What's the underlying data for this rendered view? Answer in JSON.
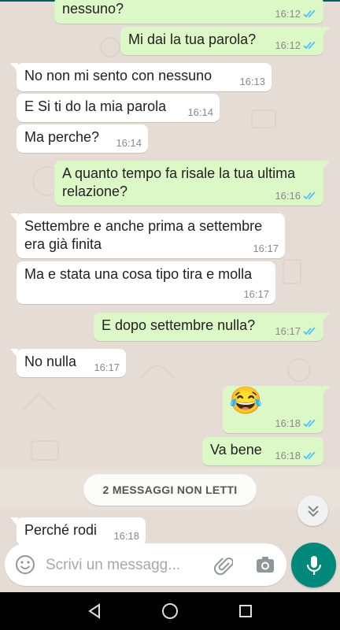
{
  "messages": [
    {
      "text": "nessuno?",
      "time": "16:12",
      "dir": "out",
      "ticks": true
    },
    {
      "text": "Mi dai la tua parola?",
      "time": "16:12",
      "dir": "out",
      "ticks": true
    },
    {
      "text": "No non mi sento con nessuno",
      "time": "16:13",
      "dir": "in",
      "ticks": false
    },
    {
      "text": "E Si ti do la mia parola",
      "time": "16:14",
      "dir": "in",
      "ticks": false
    },
    {
      "text": "Ma perche?",
      "time": "16:14",
      "dir": "in",
      "ticks": false
    },
    {
      "text": "A quanto tempo fa risale la tua ultima\nrelazione?",
      "time": "16:16",
      "dir": "out",
      "ticks": true
    },
    {
      "text": "Settembre e anche prima a settembre\nera già finita",
      "time": "16:17",
      "dir": "in",
      "ticks": false
    },
    {
      "text": "Ma e stata una cosa tipo tira e molla",
      "time": "16:17",
      "dir": "in",
      "ticks": false
    },
    {
      "text": "E dopo settembre nulla?",
      "time": "16:17",
      "dir": "out",
      "ticks": true
    },
    {
      "text": "No nulla",
      "time": "16:17",
      "dir": "in",
      "ticks": false
    },
    {
      "text": "😂",
      "time": "16:18",
      "dir": "out",
      "ticks": true
    },
    {
      "text": "Va bene",
      "time": "16:18",
      "dir": "out",
      "ticks": true
    },
    {
      "text": "Perché rodi",
      "time": "16:18",
      "dir": "in",
      "ticks": false
    }
  ],
  "unread_banner": "2 MESSAGGI NON LETTI",
  "input": {
    "placeholder": "Scrivi un messagg..."
  },
  "icons": {
    "emoji": "emoji-icon",
    "attach": "paperclip-icon",
    "camera": "camera-icon",
    "mic": "microphone-icon",
    "scroll": "double-chevron-down-icon",
    "back": "back-triangle-icon",
    "home": "home-circle-icon",
    "recents": "recents-square-icon"
  },
  "colors": {
    "outgoing": "#dcf8c6",
    "incoming": "#ffffff",
    "accent": "#00897b",
    "tick": "#4fc3f7",
    "background": "#e5ddd5"
  }
}
